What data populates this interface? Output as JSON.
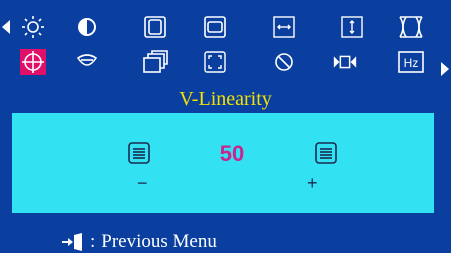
{
  "title": "V-Linearity",
  "value": "50",
  "minus_label": "−",
  "plus_label": "+",
  "footer": {
    "separator": ":",
    "label": "Previous Menu"
  },
  "menu": {
    "row1": [
      "brightness-icon",
      "contrast-icon",
      "h-position-icon",
      "v-position-icon",
      "h-size-icon",
      "v-size-icon",
      "pincushion-icon"
    ],
    "row2": [
      "v-linearity-icon",
      "trapezoid-icon",
      "parallelogram-icon",
      "rotation-icon",
      "degauss-icon",
      "moire-icon",
      "frequency-icon"
    ],
    "selected": "v-linearity-icon"
  },
  "colors": {
    "background": "#0a3fa0",
    "panel": "#33e2f2",
    "title": "#f5e000",
    "selected": "#e0106a",
    "value": "#c8258f"
  }
}
